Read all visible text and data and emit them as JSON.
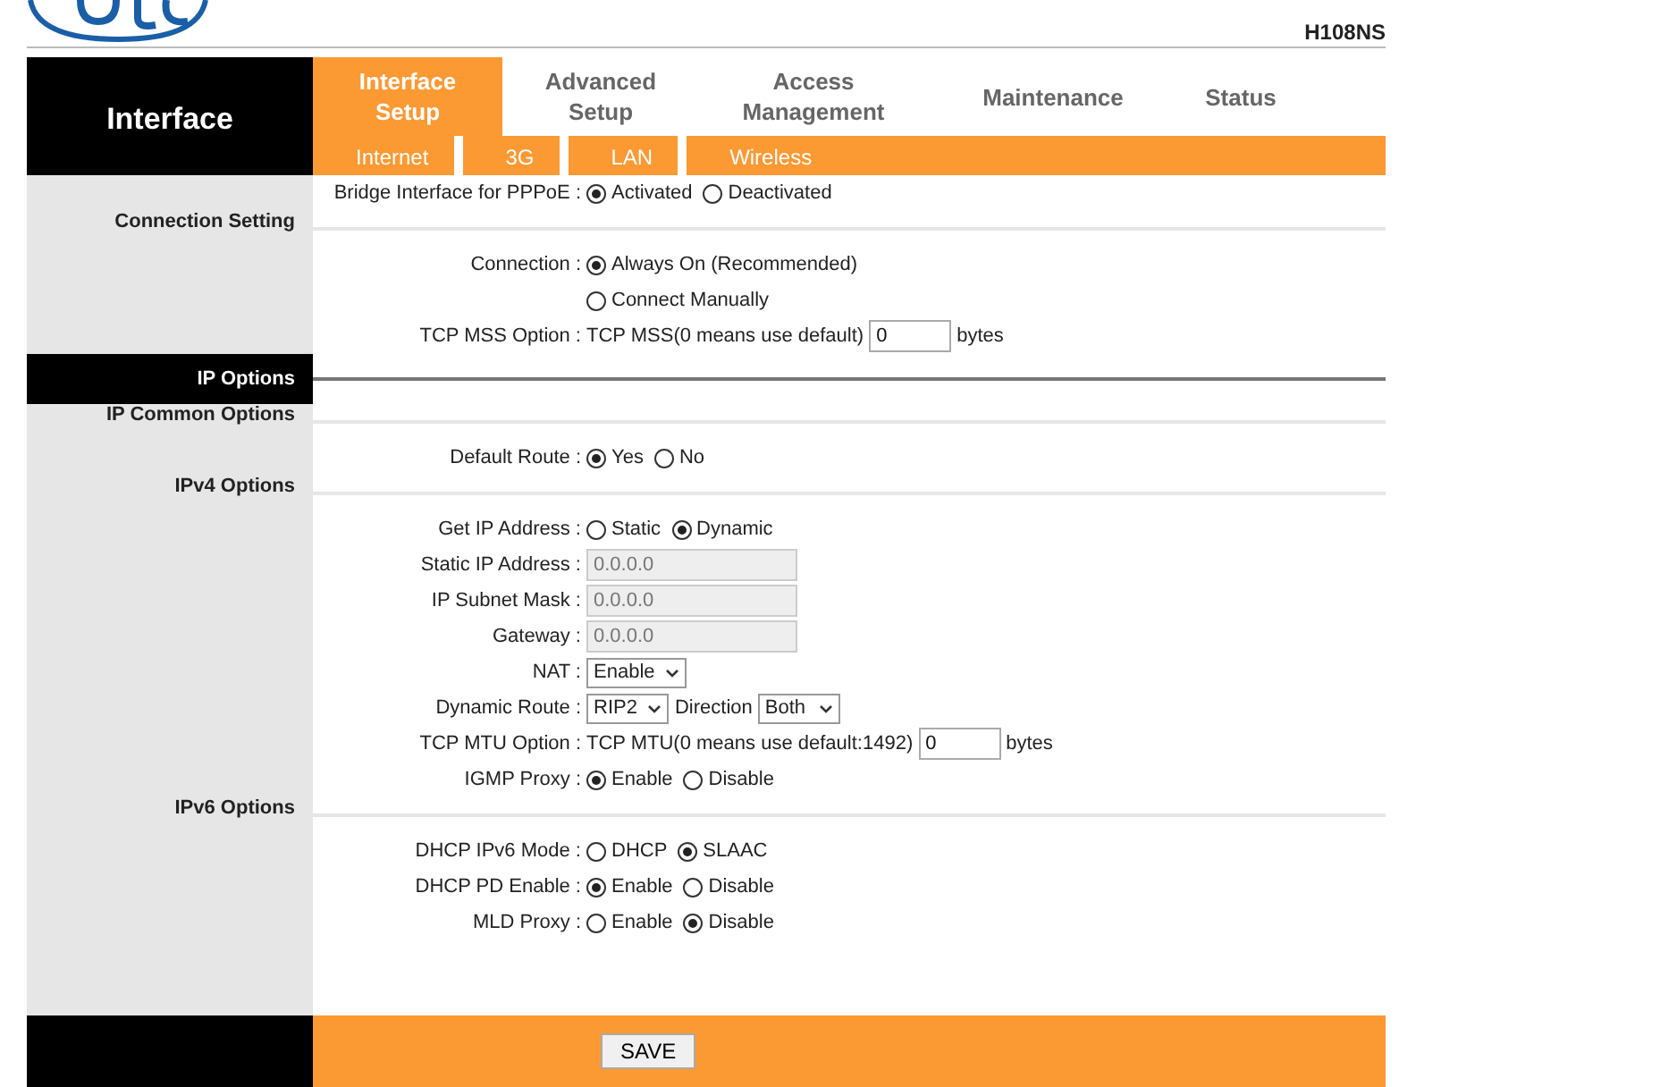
{
  "header": {
    "model": "H108NS"
  },
  "nav": {
    "title": "Interface",
    "tabs": [
      {
        "label": "Interface Setup",
        "selected": true
      },
      {
        "label": "Advanced Setup",
        "selected": false
      },
      {
        "label": "Access Management",
        "selected": false
      },
      {
        "label": "Maintenance",
        "selected": false
      },
      {
        "label": "Status",
        "selected": false
      }
    ],
    "subtabs": [
      "Internet",
      "3G",
      "LAN",
      "Wireless"
    ]
  },
  "blocks": [
    {
      "kind": "rows",
      "rows": [
        {
          "label": "Bridge Interface for PPPoE :",
          "parts": [
            {
              "kind": "radio",
              "label": "Activated",
              "selected": true
            },
            {
              "kind": "radio",
              "label": "Deactivated",
              "selected": false
            }
          ]
        }
      ]
    },
    {
      "kind": "section",
      "title": "Connection Setting",
      "rows": [
        {
          "label": "Connection :",
          "parts": [
            {
              "kind": "radio",
              "label": "Always On (Recommended)",
              "selected": true
            }
          ]
        },
        {
          "parts": [
            {
              "kind": "radio",
              "label": "Connect Manually",
              "selected": false
            }
          ]
        },
        {
          "label": "TCP MSS Option :",
          "parts": [
            {
              "kind": "text",
              "text": "TCP MSS(0 means use default)"
            },
            {
              "kind": "input",
              "value": "0",
              "disabled": false
            },
            {
              "kind": "text",
              "text": "bytes"
            }
          ]
        }
      ]
    },
    {
      "kind": "bar",
      "title": "IP Options"
    },
    {
      "kind": "section",
      "title": "IP Common Options",
      "rows": [
        {
          "label": "Default Route :",
          "parts": [
            {
              "kind": "radio",
              "label": "Yes",
              "selected": true
            },
            {
              "kind": "radio",
              "label": "No",
              "selected": false
            }
          ]
        }
      ]
    },
    {
      "kind": "section",
      "title": "IPv4 Options",
      "rows": [
        {
          "label": "Get IP Address :",
          "parts": [
            {
              "kind": "radio",
              "label": "Static",
              "selected": false
            },
            {
              "kind": "radio",
              "label": "Dynamic",
              "selected": true
            }
          ]
        },
        {
          "label": "Static IP Address :",
          "parts": [
            {
              "kind": "input",
              "value": "0.0.0.0",
              "disabled": true
            }
          ]
        },
        {
          "label": "IP Subnet Mask :",
          "parts": [
            {
              "kind": "input",
              "value": "0.0.0.0",
              "disabled": true
            }
          ]
        },
        {
          "label": "Gateway :",
          "parts": [
            {
              "kind": "input",
              "value": "0.0.0.0",
              "disabled": true
            }
          ]
        },
        {
          "label": "NAT :",
          "parts": [
            {
              "kind": "select",
              "value": "Enable"
            }
          ]
        },
        {
          "label": "Dynamic Route :",
          "parts": [
            {
              "kind": "select",
              "value": "RIP2"
            },
            {
              "kind": "text",
              "text": "Direction"
            },
            {
              "kind": "select",
              "value": "Both"
            }
          ]
        },
        {
          "label": "TCP MTU Option :",
          "parts": [
            {
              "kind": "text",
              "text": "TCP MTU(0 means use default:1492)"
            },
            {
              "kind": "input",
              "value": "0",
              "disabled": false
            },
            {
              "kind": "text",
              "text": "bytes"
            }
          ]
        },
        {
          "label": "IGMP Proxy :",
          "parts": [
            {
              "kind": "radio",
              "label": "Enable",
              "selected": true
            },
            {
              "kind": "radio",
              "label": "Disable",
              "selected": false
            }
          ]
        }
      ]
    },
    {
      "kind": "section",
      "title": "IPv6 Options",
      "rows": [
        {
          "label": "DHCP IPv6 Mode :",
          "parts": [
            {
              "kind": "radio",
              "label": "DHCP",
              "selected": false
            },
            {
              "kind": "radio",
              "label": "SLAAC",
              "selected": true
            }
          ]
        },
        {
          "label": "DHCP PD Enable :",
          "parts": [
            {
              "kind": "radio",
              "label": "Enable",
              "selected": true
            },
            {
              "kind": "radio",
              "label": "Disable",
              "selected": false
            }
          ]
        },
        {
          "label": "MLD Proxy :",
          "parts": [
            {
              "kind": "radio",
              "label": "Enable",
              "selected": false
            },
            {
              "kind": "radio",
              "label": "Disable",
              "selected": true
            }
          ]
        }
      ]
    }
  ],
  "footer": {
    "button": "SAVE"
  }
}
